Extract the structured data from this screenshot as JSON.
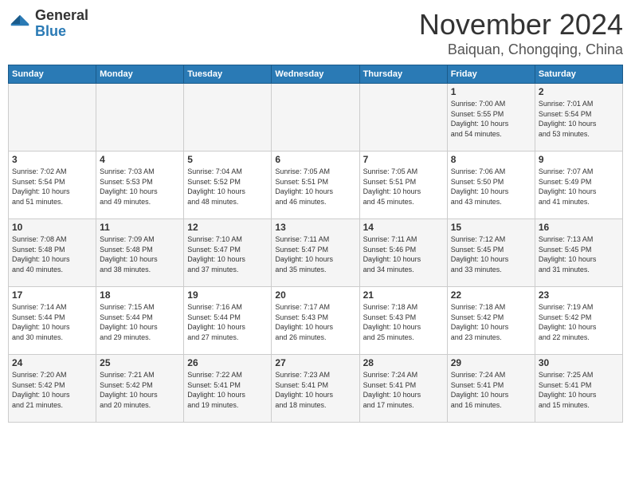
{
  "logo": {
    "general": "General",
    "blue": "Blue"
  },
  "header": {
    "month": "November 2024",
    "location": "Baiquan, Chongqing, China"
  },
  "weekdays": [
    "Sunday",
    "Monday",
    "Tuesday",
    "Wednesday",
    "Thursday",
    "Friday",
    "Saturday"
  ],
  "weeks": [
    [
      {
        "day": "",
        "info": ""
      },
      {
        "day": "",
        "info": ""
      },
      {
        "day": "",
        "info": ""
      },
      {
        "day": "",
        "info": ""
      },
      {
        "day": "",
        "info": ""
      },
      {
        "day": "1",
        "info": "Sunrise: 7:00 AM\nSunset: 5:55 PM\nDaylight: 10 hours\nand 54 minutes."
      },
      {
        "day": "2",
        "info": "Sunrise: 7:01 AM\nSunset: 5:54 PM\nDaylight: 10 hours\nand 53 minutes."
      }
    ],
    [
      {
        "day": "3",
        "info": "Sunrise: 7:02 AM\nSunset: 5:54 PM\nDaylight: 10 hours\nand 51 minutes."
      },
      {
        "day": "4",
        "info": "Sunrise: 7:03 AM\nSunset: 5:53 PM\nDaylight: 10 hours\nand 49 minutes."
      },
      {
        "day": "5",
        "info": "Sunrise: 7:04 AM\nSunset: 5:52 PM\nDaylight: 10 hours\nand 48 minutes."
      },
      {
        "day": "6",
        "info": "Sunrise: 7:05 AM\nSunset: 5:51 PM\nDaylight: 10 hours\nand 46 minutes."
      },
      {
        "day": "7",
        "info": "Sunrise: 7:05 AM\nSunset: 5:51 PM\nDaylight: 10 hours\nand 45 minutes."
      },
      {
        "day": "8",
        "info": "Sunrise: 7:06 AM\nSunset: 5:50 PM\nDaylight: 10 hours\nand 43 minutes."
      },
      {
        "day": "9",
        "info": "Sunrise: 7:07 AM\nSunset: 5:49 PM\nDaylight: 10 hours\nand 41 minutes."
      }
    ],
    [
      {
        "day": "10",
        "info": "Sunrise: 7:08 AM\nSunset: 5:48 PM\nDaylight: 10 hours\nand 40 minutes."
      },
      {
        "day": "11",
        "info": "Sunrise: 7:09 AM\nSunset: 5:48 PM\nDaylight: 10 hours\nand 38 minutes."
      },
      {
        "day": "12",
        "info": "Sunrise: 7:10 AM\nSunset: 5:47 PM\nDaylight: 10 hours\nand 37 minutes."
      },
      {
        "day": "13",
        "info": "Sunrise: 7:11 AM\nSunset: 5:47 PM\nDaylight: 10 hours\nand 35 minutes."
      },
      {
        "day": "14",
        "info": "Sunrise: 7:11 AM\nSunset: 5:46 PM\nDaylight: 10 hours\nand 34 minutes."
      },
      {
        "day": "15",
        "info": "Sunrise: 7:12 AM\nSunset: 5:45 PM\nDaylight: 10 hours\nand 33 minutes."
      },
      {
        "day": "16",
        "info": "Sunrise: 7:13 AM\nSunset: 5:45 PM\nDaylight: 10 hours\nand 31 minutes."
      }
    ],
    [
      {
        "day": "17",
        "info": "Sunrise: 7:14 AM\nSunset: 5:44 PM\nDaylight: 10 hours\nand 30 minutes."
      },
      {
        "day": "18",
        "info": "Sunrise: 7:15 AM\nSunset: 5:44 PM\nDaylight: 10 hours\nand 29 minutes."
      },
      {
        "day": "19",
        "info": "Sunrise: 7:16 AM\nSunset: 5:44 PM\nDaylight: 10 hours\nand 27 minutes."
      },
      {
        "day": "20",
        "info": "Sunrise: 7:17 AM\nSunset: 5:43 PM\nDaylight: 10 hours\nand 26 minutes."
      },
      {
        "day": "21",
        "info": "Sunrise: 7:18 AM\nSunset: 5:43 PM\nDaylight: 10 hours\nand 25 minutes."
      },
      {
        "day": "22",
        "info": "Sunrise: 7:18 AM\nSunset: 5:42 PM\nDaylight: 10 hours\nand 23 minutes."
      },
      {
        "day": "23",
        "info": "Sunrise: 7:19 AM\nSunset: 5:42 PM\nDaylight: 10 hours\nand 22 minutes."
      }
    ],
    [
      {
        "day": "24",
        "info": "Sunrise: 7:20 AM\nSunset: 5:42 PM\nDaylight: 10 hours\nand 21 minutes."
      },
      {
        "day": "25",
        "info": "Sunrise: 7:21 AM\nSunset: 5:42 PM\nDaylight: 10 hours\nand 20 minutes."
      },
      {
        "day": "26",
        "info": "Sunrise: 7:22 AM\nSunset: 5:41 PM\nDaylight: 10 hours\nand 19 minutes."
      },
      {
        "day": "27",
        "info": "Sunrise: 7:23 AM\nSunset: 5:41 PM\nDaylight: 10 hours\nand 18 minutes."
      },
      {
        "day": "28",
        "info": "Sunrise: 7:24 AM\nSunset: 5:41 PM\nDaylight: 10 hours\nand 17 minutes."
      },
      {
        "day": "29",
        "info": "Sunrise: 7:24 AM\nSunset: 5:41 PM\nDaylight: 10 hours\nand 16 minutes."
      },
      {
        "day": "30",
        "info": "Sunrise: 7:25 AM\nSunset: 5:41 PM\nDaylight: 10 hours\nand 15 minutes."
      }
    ]
  ]
}
